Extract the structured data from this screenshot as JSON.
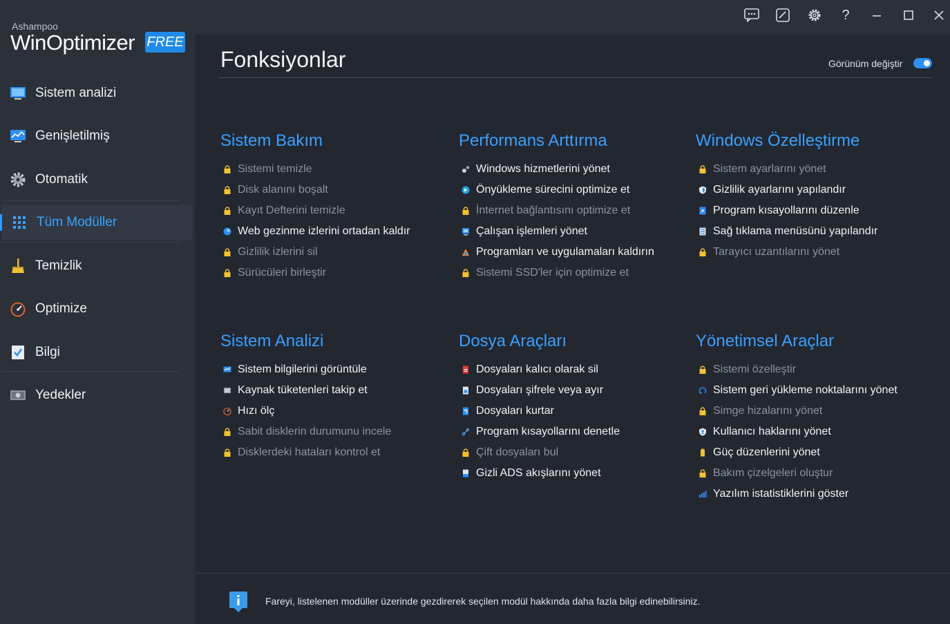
{
  "app": {
    "brand_small": "Ashampoo",
    "brand_main": "WinOptimizer",
    "badge": "FREE"
  },
  "sidebar": {
    "items": [
      {
        "label": "Sistem analizi",
        "icon": "monitor-icon"
      },
      {
        "label": "Genişletilmiş",
        "icon": "chart-monitor-icon"
      },
      {
        "label": "Otomatik",
        "icon": "gear-icon"
      },
      {
        "label": "Tüm Modüller",
        "icon": "grid-icon",
        "active": true
      },
      {
        "label": "Temizlik",
        "icon": "broom-icon"
      },
      {
        "label": "Optimize",
        "icon": "gauge-icon"
      },
      {
        "label": "Bilgi",
        "icon": "checklist-icon"
      },
      {
        "label": "Yedekler",
        "icon": "backup-drive-icon"
      }
    ]
  },
  "titlebar": {
    "icons": [
      "feedback-icon",
      "edit-icon",
      "settings-icon",
      "help-icon",
      "minimize-icon",
      "maximize-icon",
      "close-icon"
    ],
    "help_glyph": "?"
  },
  "page": {
    "title": "Fonksiyonlar",
    "view_toggle_label": "Görünüm değiştir",
    "view_toggle_on": true
  },
  "accent": "#3ba0ff",
  "categories": [
    {
      "title": "Sistem Bakım",
      "modules": [
        {
          "label": "Sistemi temizle",
          "locked": true
        },
        {
          "label": "Disk alanını boşalt",
          "locked": true
        },
        {
          "label": "Kayıt Defterini temizle",
          "locked": true
        },
        {
          "label": "Web gezinme izlerini ortadan kaldır",
          "locked": false,
          "icon": "globe-icon"
        },
        {
          "label": "Gizlilik izlerini sil",
          "locked": true
        },
        {
          "label": "Sürücüleri birleştir",
          "locked": true
        }
      ]
    },
    {
      "title": "Performans Arttırma",
      "modules": [
        {
          "label": "Windows hizmetlerini yönet",
          "locked": false,
          "icon": "gears-icon"
        },
        {
          "label": "Önyükleme sürecini optimize et",
          "locked": false,
          "icon": "boot-icon"
        },
        {
          "label": "İnternet bağlantısını optimize et",
          "locked": true
        },
        {
          "label": "Çalışan işlemleri yönet",
          "locked": false,
          "icon": "process-icon"
        },
        {
          "label": "Programları ve uygulamaları kaldırın",
          "locked": false,
          "icon": "uninstall-icon"
        },
        {
          "label": "Sistemi SSD'ler için optimize et",
          "locked": true
        }
      ]
    },
    {
      "title": "Windows Özelleştirme",
      "modules": [
        {
          "label": "Sistem ayarlarını yönet",
          "locked": true
        },
        {
          "label": "Gizlilik ayarlarını yapılandır",
          "locked": false,
          "icon": "shield-icon"
        },
        {
          "label": "Program kısayollarını düzenle",
          "locked": false,
          "icon": "shortcut-icon"
        },
        {
          "label": "Sağ tıklama menüsünü yapılandır",
          "locked": false,
          "icon": "menu-icon"
        },
        {
          "label": "Tarayıcı uzantılarını yönet",
          "locked": true
        }
      ]
    },
    {
      "title": "Sistem Analizi",
      "modules": [
        {
          "label": "Sistem bilgilerini görüntüle",
          "locked": false,
          "icon": "sysinfo-icon"
        },
        {
          "label": "Kaynak tüketenleri takip et",
          "locked": false,
          "icon": "resource-icon"
        },
        {
          "label": "Hızı ölç",
          "locked": false,
          "icon": "speed-icon"
        },
        {
          "label": "Sabit disklerin durumunu incele",
          "locked": true
        },
        {
          "label": "Disklerdeki hataları kontrol et",
          "locked": true
        }
      ]
    },
    {
      "title": "Dosya Araçları",
      "modules": [
        {
          "label": "Dosyaları kalıcı olarak sil",
          "locked": false,
          "icon": "shred-icon"
        },
        {
          "label": "Dosyaları şifrele veya ayır",
          "locked": false,
          "icon": "encrypt-icon"
        },
        {
          "label": "Dosyaları kurtar",
          "locked": false,
          "icon": "recover-icon"
        },
        {
          "label": "Program kısayollarını denetle",
          "locked": false,
          "icon": "link-icon"
        },
        {
          "label": "Çift dosyaları bul",
          "locked": true
        },
        {
          "label": "Gizli ADS akışlarını yönet",
          "locked": false,
          "icon": "ads-icon"
        }
      ]
    },
    {
      "title": "Yönetimsel Araçlar",
      "modules": [
        {
          "label": "Sistemi özelleştir",
          "locked": true
        },
        {
          "label": "Sistem geri yükleme noktalarını yönet",
          "locked": false,
          "icon": "restore-icon"
        },
        {
          "label": "Simge hizalarını yönet",
          "locked": true
        },
        {
          "label": "Kullanıcı haklarını yönet",
          "locked": false,
          "icon": "user-shield-icon"
        },
        {
          "label": "Güç düzenlerini yönet",
          "locked": false,
          "icon": "battery-icon"
        },
        {
          "label": "Bakım çizelgeleri oluştur",
          "locked": true
        },
        {
          "label": "Yazılım istatistiklerini göster",
          "locked": false,
          "icon": "stats-icon"
        }
      ]
    }
  ],
  "footer": {
    "text": "Fareyi, listelenen modüller üzerinde gezdirerek seçilen modül hakkında daha fazla bilgi edinebilirsiniz.",
    "icon": "info-icon"
  }
}
